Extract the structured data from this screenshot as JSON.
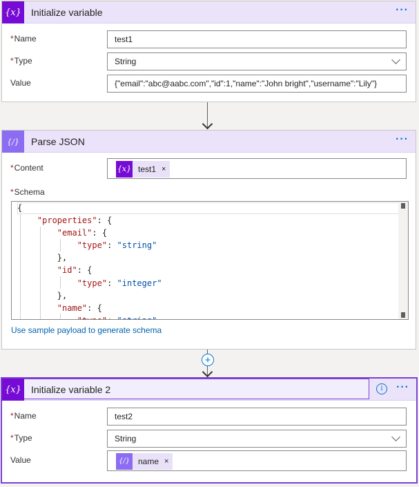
{
  "card1": {
    "icon": "{x}",
    "icon_name": "variable-icon",
    "title": "Initialize variable",
    "more": "···",
    "name_label": "Name",
    "name_value": "test1",
    "type_label": "Type",
    "type_value": "String",
    "value_label": "Value",
    "value_value": "{\"email\":\"abc@aabc.com\",\"id\":1,\"name\":\"John bright\",\"username\":\"Lily\"}"
  },
  "card2": {
    "icon": "{/}",
    "icon_name": "parse-json-icon",
    "title": "Parse JSON",
    "more": "···",
    "content_label": "Content",
    "content_token": "test1",
    "schema_label": "Schema",
    "schema_lines": [
      "{",
      "    \"properties\": {",
      "        \"email\": {",
      "            \"type\": \"string\"",
      "        },",
      "        \"id\": {",
      "            \"type\": \"integer\"",
      "        },",
      "        \"name\": {",
      "            \"type\": \"string\""
    ],
    "sample_link": "Use sample payload to generate schema"
  },
  "card3": {
    "icon": "{x}",
    "title": "Initialize variable 2",
    "info": "i",
    "more": "···",
    "name_label": "Name",
    "name_value": "test2",
    "type_label": "Type",
    "type_value": "String",
    "value_label": "Value",
    "value_token": "name"
  },
  "token_remove": "×",
  "required_mark": "*",
  "add_step": "+",
  "colors": {
    "variable": "#770bd6",
    "parse": "#8c6cf2",
    "header_bg": "#ebe3fa",
    "link": "#0062ad",
    "selected_border": "#7b3fd6"
  }
}
